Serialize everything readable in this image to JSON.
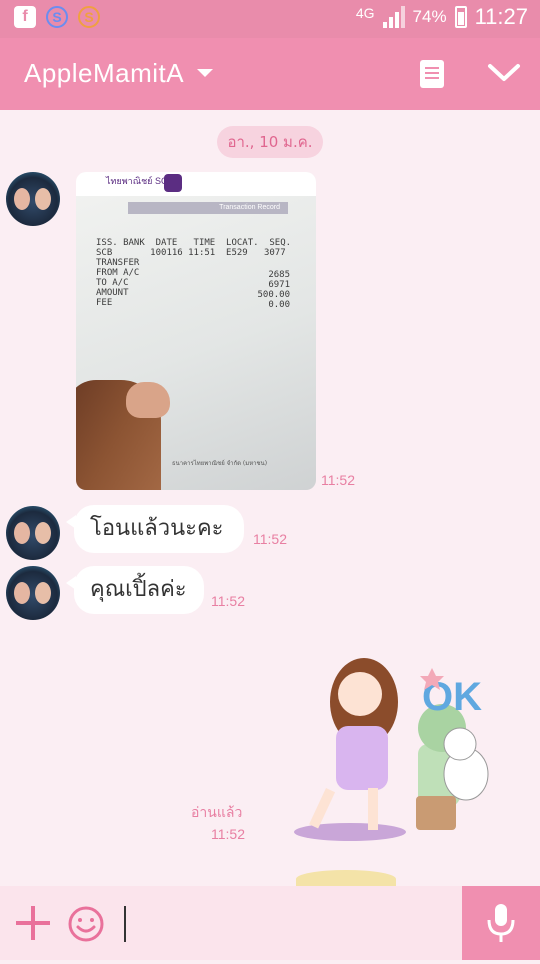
{
  "status_bar": {
    "network": "4G",
    "battery": "74%",
    "time": "11:27",
    "icons": [
      "facebook-icon",
      "s-app-icon",
      "s-app-icon"
    ]
  },
  "header": {
    "title": "AppleMamitA",
    "icons": [
      "chevron-down-icon",
      "notes-icon",
      "check-icon"
    ]
  },
  "chat": {
    "date": "อา., 10 ม.ค.",
    "messages": [
      {
        "type": "image",
        "time": "11:52",
        "receipt": {
          "bank": "ไทยพาณิชย์ SCB",
          "band": "Transaction Record",
          "fields": "ISS. BANK  DATE   TIME  LOCAT.  SEQ.\nSCB       100116 11:51  E529   3077\nTRANSFER\nFROM A/C\nTO A/C\nAMOUNT\nFEE",
          "values": [
            "2685",
            "6971",
            "500.00",
            "0.00"
          ],
          "footer": "ธนาคารไทยพาณิชย์ จำกัด (มหาชน)"
        }
      },
      {
        "type": "text",
        "text": "โอนแล้วนะคะ",
        "time": "11:52"
      },
      {
        "type": "text",
        "text": "คุณเปิ้ลค่ะ",
        "time": "11:52"
      },
      {
        "type": "sticker",
        "read_label": "อ่านแล้ว",
        "time": "11:52",
        "sticker_text": "OK"
      }
    ]
  },
  "input": {
    "placeholder": "",
    "icons": [
      "plus-icon",
      "emoji-icon",
      "mic-icon"
    ]
  },
  "colors": {
    "status_bar": "#e98cab",
    "header": "#f08fb0",
    "background": "#fbeef3",
    "accent_text": "#e87fa2"
  }
}
